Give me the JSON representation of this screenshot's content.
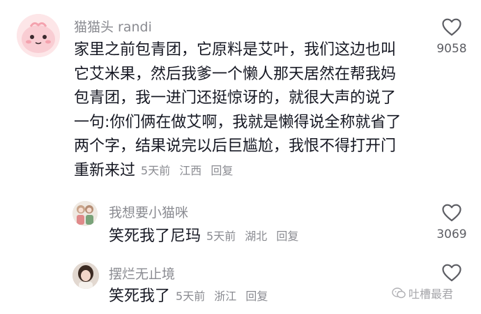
{
  "comments": [
    {
      "username": "猫猫头 randi",
      "avatar_icon": "pink-cartoon-face-icon",
      "lines": [
        "家里之前包青团，它原料是艾叶，我们这边也叫",
        "它艾米果，然后我爹一个懒人那天居然在帮我妈",
        "包青团，我一进门还挺惊讶的，就很大声的说了",
        "一句:你们俩在做艾啊，我就是懒得说全称就省了",
        "两个字，结果说完以后巨尴尬，我恨不得打开门",
        "重新来过"
      ],
      "time": "5天前",
      "location": "江西",
      "reply": "回复",
      "likes": "9058"
    },
    {
      "username": "我想要小猫咪",
      "avatar_icon": "anime-girls-avatar-icon",
      "lines": [
        "笑死我了尼玛"
      ],
      "time": "5天前",
      "location": "湖北",
      "reply": "回复",
      "likes": "3069"
    },
    {
      "username": "摆烂无止境",
      "avatar_icon": "girl-photo-avatar-icon",
      "lines": [
        "笑死我了"
      ],
      "time": "5天前",
      "location": "浙江",
      "reply": "回复",
      "likes": ""
    }
  ],
  "watermark": {
    "text": "吐槽最君",
    "icon": "wechat-logo-icon"
  },
  "colors": {
    "text": "#161823",
    "secondary": "#8a8b91",
    "count": "#5c5d63"
  }
}
